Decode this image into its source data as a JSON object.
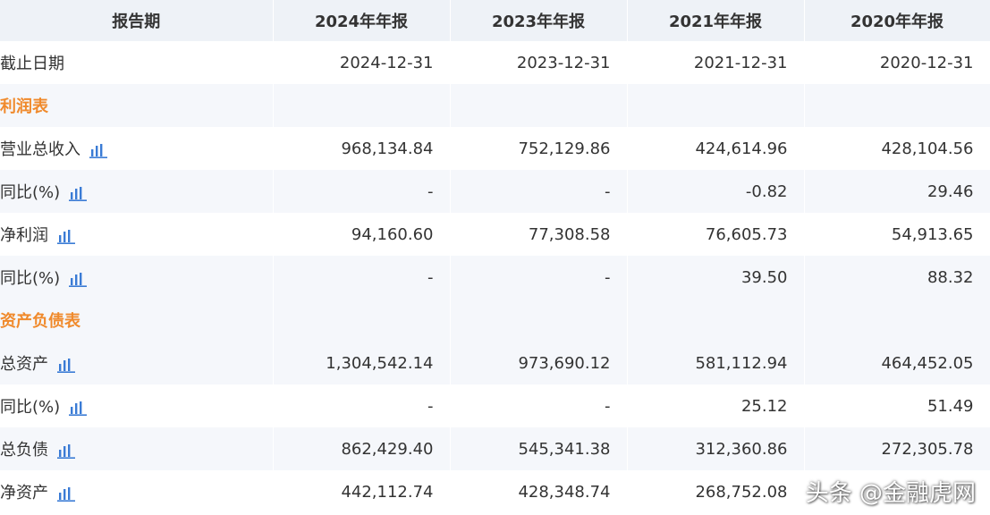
{
  "header": {
    "col0": "报告期",
    "col1": "2024年年报",
    "col2": "2023年年报",
    "col3": "2021年年报",
    "col4": "2020年年报"
  },
  "rows": {
    "date": {
      "label": "截止日期",
      "v": [
        "2024-12-31",
        "2023-12-31",
        "2021-12-31",
        "2020-12-31"
      ]
    },
    "sec_income": {
      "label": "利润表"
    },
    "revenue": {
      "label": "营业总收入",
      "v": [
        "968,134.84",
        "752,129.86",
        "424,614.96",
        "428,104.56"
      ]
    },
    "revenue_yoy": {
      "label": "同比(%)",
      "v": [
        "-",
        "-",
        "-0.82",
        "29.46"
      ]
    },
    "net_profit": {
      "label": "净利润",
      "v": [
        "94,160.60",
        "77,308.58",
        "76,605.73",
        "54,913.65"
      ]
    },
    "net_profit_yoy": {
      "label": "同比(%)",
      "v": [
        "-",
        "-",
        "39.50",
        "88.32"
      ]
    },
    "sec_balance": {
      "label": "资产负债表"
    },
    "total_assets": {
      "label": "总资产",
      "v": [
        "1,304,542.14",
        "973,690.12",
        "581,112.94",
        "464,452.05"
      ]
    },
    "total_assets_yoy": {
      "label": "同比(%)",
      "v": [
        "-",
        "-",
        "25.12",
        "51.49"
      ]
    },
    "total_liabilities": {
      "label": "总负债",
      "v": [
        "862,429.40",
        "545,341.38",
        "312,360.86",
        "272,305.78"
      ]
    },
    "net_assets": {
      "label": "净资产",
      "v": [
        "442,112.74",
        "428,348.74",
        "268,752.08",
        ""
      ]
    }
  },
  "watermark": "头条 @金融虎网",
  "colors": {
    "header_bg": "#eef2f7",
    "stripe_bg": "#f5f7fb",
    "section_title": "#f08a2c",
    "chart_icon": "#3a7bd5"
  }
}
